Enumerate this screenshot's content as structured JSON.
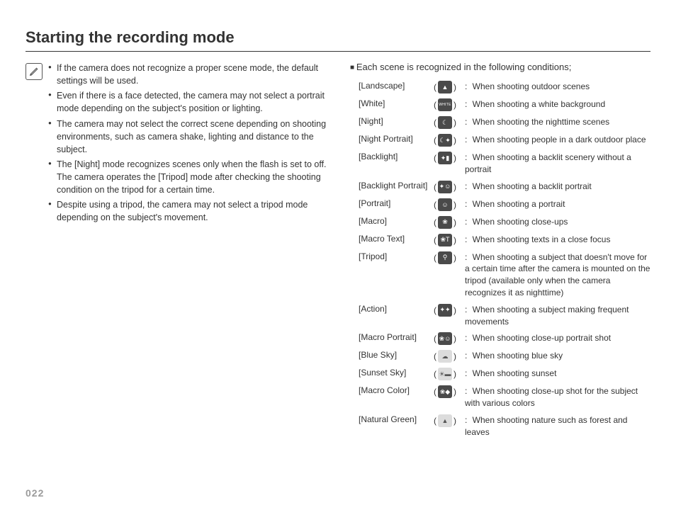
{
  "title": "Starting the recording mode",
  "page_number": "022",
  "notes": [
    "If the camera does not recognize a proper scene mode, the default settings will be used.",
    "Even if there is a face detected, the camera may not select a portrait mode depending on the subject's position or lighting.",
    "The camera may not select the correct scene depending on shooting environments, such as camera shake, lighting and distance to the subject.",
    "The [Night] mode recognizes scenes only when the flash is set to off. The camera operates the [Tripod] mode after checking the shooting condition on the tripod for a certain time.",
    "Despite using a tripod, the camera may not select a tripod mode depending on the subject's movement."
  ],
  "scene_intro": "Each scene is recognized in the following conditions;",
  "scenes": [
    {
      "name": "[Landscape]",
      "icon": "landscape-icon",
      "style": "dark",
      "glyph": "▲",
      "desc": "When shooting outdoor scenes"
    },
    {
      "name": "[White]",
      "icon": "white-icon",
      "style": "dark",
      "glyph": "WHITE",
      "desc": "When shooting a white background"
    },
    {
      "name": "[Night]",
      "icon": "night-icon",
      "style": "dark",
      "glyph": "☾",
      "desc": "When shooting the nighttime scenes"
    },
    {
      "name": "[Night Portrait]",
      "icon": "night-portrait-icon",
      "style": "dark",
      "glyph": "☾✦",
      "desc": "When shooting people in a dark outdoor place"
    },
    {
      "name": "[Backlight]",
      "icon": "backlight-icon",
      "style": "dark",
      "glyph": "✦▮",
      "desc": "When shooting a backlit scenery without a portrait"
    },
    {
      "name": "[Backlight Portrait]",
      "icon": "backlight-portrait-icon",
      "style": "dark",
      "glyph": "✦☺",
      "desc": "When shooting a backlit portrait"
    },
    {
      "name": "[Portrait]",
      "icon": "portrait-icon",
      "style": "dark",
      "glyph": "☺",
      "desc": "When shooting a portrait"
    },
    {
      "name": "[Macro]",
      "icon": "macro-icon",
      "style": "dark",
      "glyph": "❀",
      "desc": "When shooting close-ups"
    },
    {
      "name": "[Macro Text]",
      "icon": "macro-text-icon",
      "style": "dark",
      "glyph": "❀T",
      "desc": "When shooting texts in a close focus"
    },
    {
      "name": "[Tripod]",
      "icon": "tripod-icon",
      "style": "dark",
      "glyph": "⚲",
      "desc": "When shooting a subject that doesn't move for a certain time after the camera is mounted on the tripod (available only when the camera recognizes it as nighttime)"
    },
    {
      "name": "[Action]",
      "icon": "action-icon",
      "style": "dark",
      "glyph": "✦✦",
      "desc": "When shooting a subject making frequent movements"
    },
    {
      "name": "[Macro Portrait]",
      "icon": "macro-portrait-icon",
      "style": "dark",
      "glyph": "❀☺",
      "desc": "When shooting close-up portrait shot"
    },
    {
      "name": "[Blue Sky]",
      "icon": "blue-sky-icon",
      "style": "light",
      "glyph": "☁",
      "desc": "When shooting blue sky"
    },
    {
      "name": "[Sunset Sky]",
      "icon": "sunset-sky-icon",
      "style": "light",
      "glyph": "☀▬",
      "desc": "When shooting sunset"
    },
    {
      "name": "[Macro Color]",
      "icon": "macro-color-icon",
      "style": "dark",
      "glyph": "❀◆",
      "desc": "When shooting close-up shot for the subject with various colors"
    },
    {
      "name": "[Natural Green]",
      "icon": "natural-green-icon",
      "style": "light",
      "glyph": "▲",
      "desc": "When shooting nature such as forest and leaves"
    }
  ]
}
